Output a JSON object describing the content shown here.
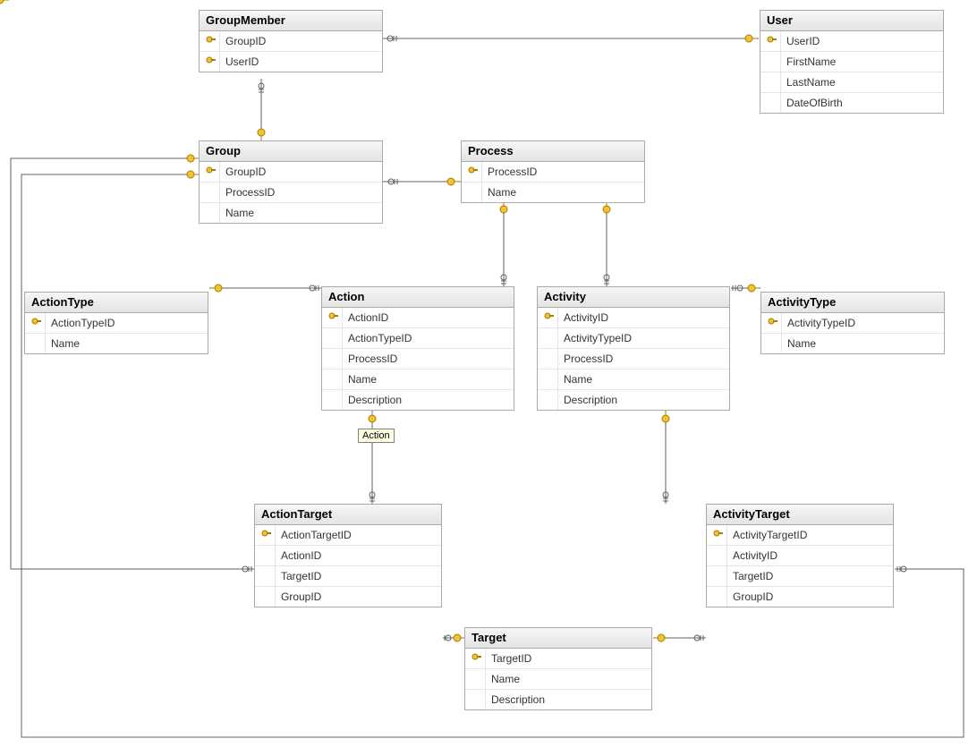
{
  "tables": {
    "groupmember": {
      "title": "GroupMember",
      "fields": [
        {
          "name": "GroupID",
          "pk": true
        },
        {
          "name": "UserID",
          "pk": true
        }
      ]
    },
    "user": {
      "title": "User",
      "fields": [
        {
          "name": "UserID",
          "pk": true
        },
        {
          "name": "FirstName",
          "pk": false
        },
        {
          "name": "LastName",
          "pk": false
        },
        {
          "name": "DateOfBirth",
          "pk": false
        }
      ]
    },
    "group": {
      "title": "Group",
      "fields": [
        {
          "name": "GroupID",
          "pk": true
        },
        {
          "name": "ProcessID",
          "pk": false
        },
        {
          "name": "Name",
          "pk": false
        }
      ]
    },
    "process": {
      "title": "Process",
      "fields": [
        {
          "name": "ProcessID",
          "pk": true
        },
        {
          "name": "Name",
          "pk": false
        }
      ]
    },
    "actiontype": {
      "title": "ActionType",
      "fields": [
        {
          "name": "ActionTypeID",
          "pk": true
        },
        {
          "name": "Name",
          "pk": false
        }
      ]
    },
    "action": {
      "title": "Action",
      "fields": [
        {
          "name": "ActionID",
          "pk": true
        },
        {
          "name": "ActionTypeID",
          "pk": false
        },
        {
          "name": "ProcessID",
          "pk": false
        },
        {
          "name": "Name",
          "pk": false
        },
        {
          "name": "Description",
          "pk": false
        }
      ]
    },
    "activity": {
      "title": "Activity",
      "fields": [
        {
          "name": "ActivityID",
          "pk": true
        },
        {
          "name": "ActivityTypeID",
          "pk": false
        },
        {
          "name": "ProcessID",
          "pk": false
        },
        {
          "name": "Name",
          "pk": false
        },
        {
          "name": "Description",
          "pk": false
        }
      ]
    },
    "activitytype": {
      "title": "ActivityType",
      "fields": [
        {
          "name": "ActivityTypeID",
          "pk": true
        },
        {
          "name": "Name",
          "pk": false
        }
      ]
    },
    "actiontarget": {
      "title": "ActionTarget",
      "fields": [
        {
          "name": "ActionTargetID",
          "pk": true
        },
        {
          "name": "ActionID",
          "pk": false
        },
        {
          "name": "TargetID",
          "pk": false
        },
        {
          "name": "GroupID",
          "pk": false
        }
      ]
    },
    "activitytarget": {
      "title": "ActivityTarget",
      "fields": [
        {
          "name": "ActivityTargetID",
          "pk": true
        },
        {
          "name": "ActivityID",
          "pk": false
        },
        {
          "name": "TargetID",
          "pk": false
        },
        {
          "name": "GroupID",
          "pk": false
        }
      ]
    },
    "target": {
      "title": "Target",
      "fields": [
        {
          "name": "TargetID",
          "pk": true
        },
        {
          "name": "Name",
          "pk": false
        },
        {
          "name": "Description",
          "pk": false
        }
      ]
    }
  },
  "tooltip": "Action"
}
